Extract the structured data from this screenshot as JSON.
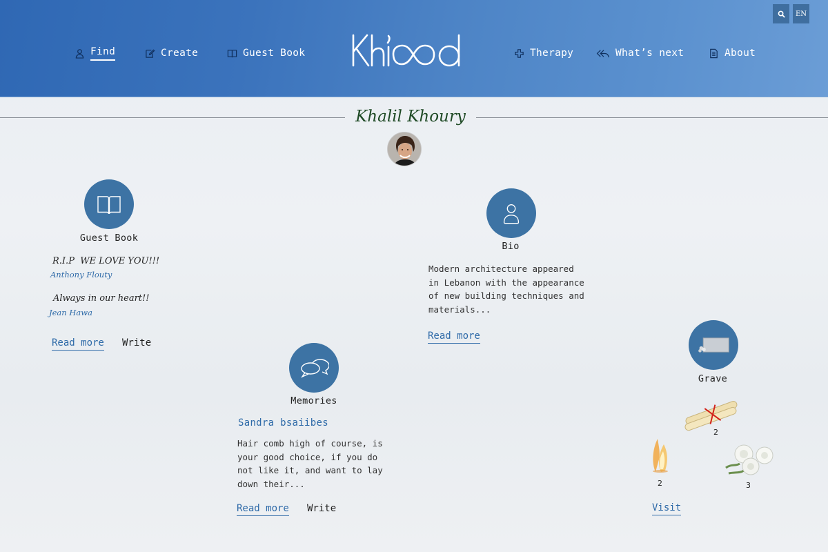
{
  "header": {
    "nav_left": [
      {
        "label": "Find",
        "icon": "user-icon",
        "active": true
      },
      {
        "label": "Create",
        "icon": "edit-icon"
      },
      {
        "label": "Guest Book",
        "icon": "book-icon"
      }
    ],
    "nav_right": [
      {
        "label": "Therapy",
        "icon": "cross-icon"
      },
      {
        "label": "What’s next",
        "icon": "reply-all-icon"
      },
      {
        "label": "About",
        "icon": "document-icon"
      }
    ],
    "logo_text": "Khlood",
    "language": "EN",
    "search_icon": "search-icon"
  },
  "person": {
    "name": "Khalil Khoury"
  },
  "guestbook": {
    "title": "Guest Book",
    "entries": [
      {
        "message": "R.I.P  WE LOVE YOU!!!",
        "author": "Anthony Flouty"
      },
      {
        "message": "Always in our heart!!",
        "author": "Jean Hawa"
      }
    ],
    "read_more": "Read more",
    "write": "Write"
  },
  "bio": {
    "title": "Bio",
    "lines": [
      "Modern architecture appeared",
      "in Lebanon with the appearance",
      "of new building techniques and",
      "materials..."
    ],
    "read_more": "Read more"
  },
  "memories": {
    "title": "Memories",
    "author": "Sandra bsaiibes",
    "lines": [
      "Hair comb high of course, is",
      "your good choice, if you do",
      "not like it, and want to lay",
      "down their..."
    ],
    "read_more": "Read more",
    "write": "Write"
  },
  "grave": {
    "title": "Grave",
    "gifts": {
      "scroll_count": "2",
      "candle_count": "2",
      "flowers_count": "3"
    },
    "visit": "Visit"
  },
  "colors": {
    "header_gradient_start": "#2f68b4",
    "header_gradient_end": "#6b9dd6",
    "circle": "#3d73a4",
    "link": "#2e6aa8",
    "name": "#1f4a25"
  }
}
